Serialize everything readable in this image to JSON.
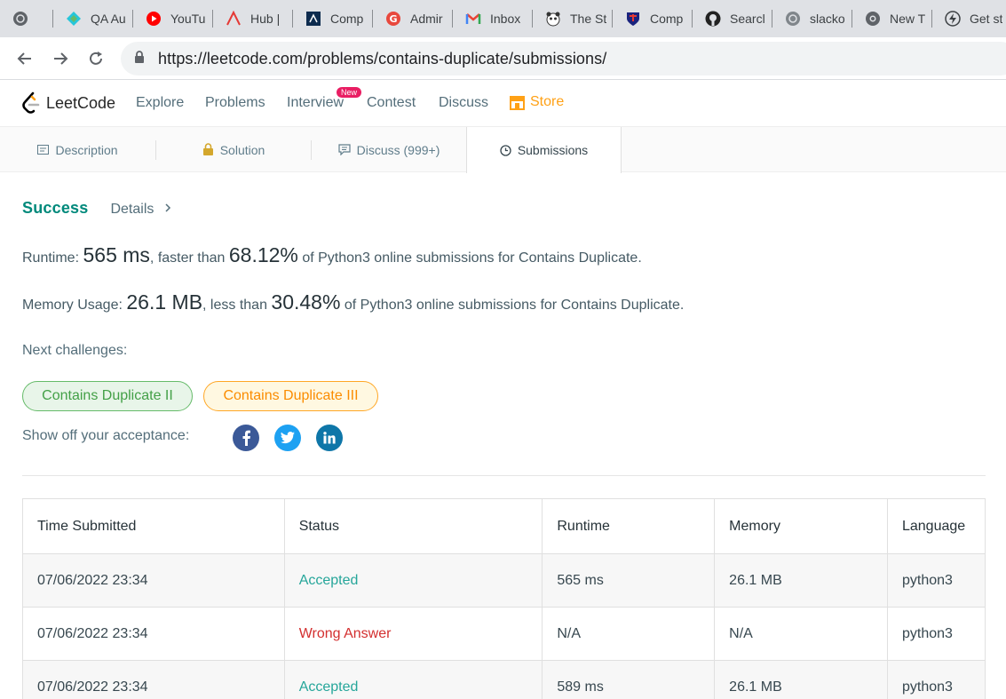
{
  "browser": {
    "tabs": [
      {
        "label": "",
        "icon": "globe-icon"
      },
      {
        "label": "QA Au",
        "icon": "qa-diamond-icon"
      },
      {
        "label": "YouTu",
        "icon": "youtube-icon"
      },
      {
        "label": "Hub |",
        "icon": "hub-logo-icon"
      },
      {
        "label": "Comp",
        "icon": "company-logo-icon"
      },
      {
        "label": "Admir",
        "icon": "g-logo-icon"
      },
      {
        "label": "Inbox",
        "icon": "gmail-icon"
      },
      {
        "label": "The St",
        "icon": "panda-icon"
      },
      {
        "label": "Comp",
        "icon": "shield-crest-icon"
      },
      {
        "label": "Searcl",
        "icon": "github-icon"
      },
      {
        "label": "slacko",
        "icon": "globe-icon"
      },
      {
        "label": "New T",
        "icon": "chrome-icon"
      },
      {
        "label": "Get st",
        "icon": "bolt-icon"
      }
    ],
    "url": "https://leetcode.com/problems/contains-duplicate/submissions/"
  },
  "nav": {
    "brand": "LeetCode",
    "links": [
      "Explore",
      "Problems",
      "Interview",
      "Contest",
      "Discuss"
    ],
    "new_badge": "New",
    "store": "Store"
  },
  "problem_tabs": {
    "description": "Description",
    "solution": "Solution",
    "discuss": "Discuss (999+)",
    "submissions": "Submissions"
  },
  "result": {
    "status": "Success",
    "details": "Details",
    "runtime_label": "Runtime:",
    "runtime_value": "565 ms",
    "runtime_mid": ", faster than",
    "runtime_pct": "68.12%",
    "runtime_tail": "of Python3 online submissions for Contains Duplicate.",
    "memory_label": "Memory Usage:",
    "memory_value": "26.1 MB",
    "memory_mid": ", less than",
    "memory_pct": "30.48%",
    "memory_tail": "of Python3 online submissions for Contains Duplicate.",
    "next_challenges_label": "Next challenges:",
    "challenges": [
      "Contains Duplicate II",
      "Contains Duplicate III"
    ],
    "share_label": "Show off your acceptance:"
  },
  "submissions_table": {
    "headers": [
      "Time Submitted",
      "Status",
      "Runtime",
      "Memory",
      "Language"
    ],
    "rows": [
      [
        "07/06/2022 23:34",
        "Accepted",
        "565 ms",
        "26.1 MB",
        "python3"
      ],
      [
        "07/06/2022 23:34",
        "Wrong Answer",
        "N/A",
        "N/A",
        "python3"
      ],
      [
        "07/06/2022 23:34",
        "Accepted",
        "589 ms",
        "26.1 MB",
        "python3"
      ]
    ]
  },
  "colors": {
    "accent_green": "#00897b",
    "store_orange": "#ffa116",
    "wrong_red": "#d32f2f",
    "facebook": "#3b5998",
    "twitter": "#1da1f2",
    "linkedin": "#0e76a8"
  }
}
